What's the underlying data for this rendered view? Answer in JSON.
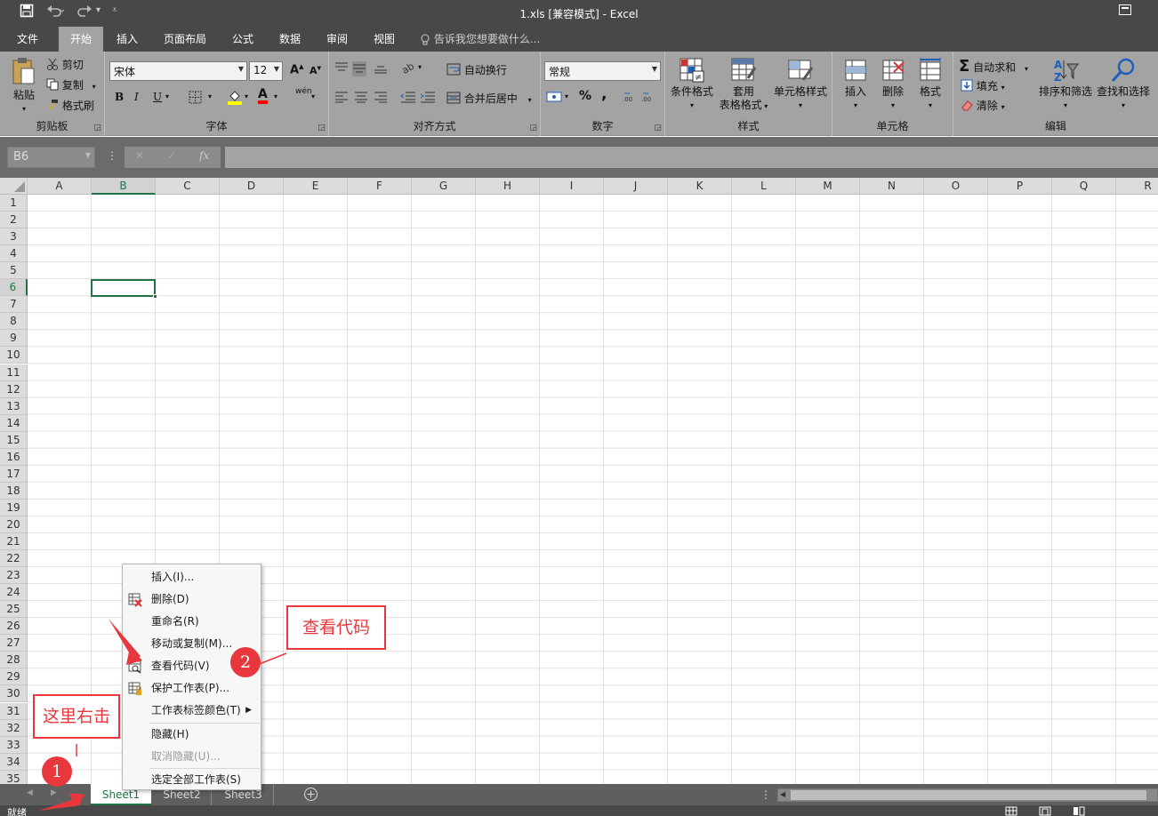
{
  "titlebar": {
    "title": "1.xls  [兼容模式] - Excel",
    "save_icon": "save-icon",
    "undo_icon": "undo-icon",
    "redo_icon": "redo-icon"
  },
  "menu": {
    "tabs": [
      "文件",
      "开始",
      "插入",
      "页面布局",
      "公式",
      "数据",
      "审阅",
      "视图"
    ],
    "active": "开始",
    "tell_me": "告诉我您想要做什么..."
  },
  "ribbon": {
    "clipboard": {
      "label": "剪贴板",
      "paste": "粘贴",
      "cut": "剪切",
      "copy": "复制",
      "format_painter": "格式刷"
    },
    "font": {
      "label": "字体",
      "name": "宋体",
      "size": "12",
      "bold": "B",
      "italic": "I",
      "underline": "U",
      "grow": "A",
      "shrink": "A",
      "font_color": "A",
      "phonetic": "wén"
    },
    "alignment": {
      "label": "对齐方式",
      "wrap": "自动换行",
      "merge": "合并后居中"
    },
    "number": {
      "label": "数字",
      "format": "常规",
      "percent": "%",
      "comma": ","
    },
    "styles": {
      "label": "样式",
      "conditional": "条件格式",
      "table_line1": "套用",
      "table_line2": "表格格式",
      "cell_styles": "单元格样式"
    },
    "cells": {
      "label": "单元格",
      "insert": "插入",
      "delete": "删除",
      "format": "格式"
    },
    "editing": {
      "label": "编辑",
      "autosum": "自动求和",
      "fill": "填充",
      "clear": "清除",
      "sort": "排序和筛选",
      "find": "查找和选择"
    }
  },
  "formula_bar": {
    "name_box": "B6",
    "cancel": "✕",
    "enter": "✓",
    "fx": "fx",
    "value": ""
  },
  "grid": {
    "columns": [
      "A",
      "B",
      "C",
      "D",
      "E",
      "F",
      "G",
      "H",
      "I",
      "J",
      "K",
      "L",
      "M",
      "N",
      "O",
      "P",
      "Q",
      "R"
    ],
    "rows": [
      "1",
      "2",
      "3",
      "4",
      "5",
      "6",
      "7",
      "8",
      "9",
      "10",
      "11",
      "12",
      "13",
      "14",
      "15",
      "16",
      "17",
      "18",
      "19",
      "20",
      "21",
      "22",
      "23",
      "24",
      "25",
      "26",
      "27",
      "28",
      "29",
      "30",
      "31",
      "32",
      "33",
      "34",
      "35"
    ],
    "selected_cell": "B6"
  },
  "context_menu": {
    "items": [
      {
        "label": "插入(I)...",
        "icon": ""
      },
      {
        "label": "删除(D)",
        "icon": "delete-sheet-icon"
      },
      {
        "label": "重命名(R)",
        "icon": ""
      },
      {
        "label": "移动或复制(M)...",
        "icon": ""
      },
      {
        "label": "查看代码(V)",
        "icon": "view-code-icon"
      },
      {
        "label": "保护工作表(P)...",
        "icon": "protect-sheet-icon"
      },
      {
        "label": "工作表标签颜色(T)",
        "icon": "",
        "submenu": true
      },
      {
        "label": "隐藏(H)",
        "icon": ""
      },
      {
        "label": "取消隐藏(U)...",
        "icon": "",
        "disabled": true
      },
      {
        "label": "选定全部工作表(S)",
        "icon": ""
      }
    ]
  },
  "sheets": {
    "tabs": [
      "Sheet1",
      "Sheet2",
      "Sheet3"
    ],
    "active": "Sheet1",
    "add_icon": "add-sheet-icon"
  },
  "status": {
    "text": "就绪"
  },
  "annotations": {
    "callout_right_click": "这里右击",
    "callout_view_code": "查看代码",
    "badge_1": "1",
    "badge_2": "2",
    "accent_color": "#e8383d"
  },
  "colors": {
    "excel_green": "#217346",
    "chrome_dark": "#484848",
    "ribbon_gray": "#a3a3a3"
  }
}
